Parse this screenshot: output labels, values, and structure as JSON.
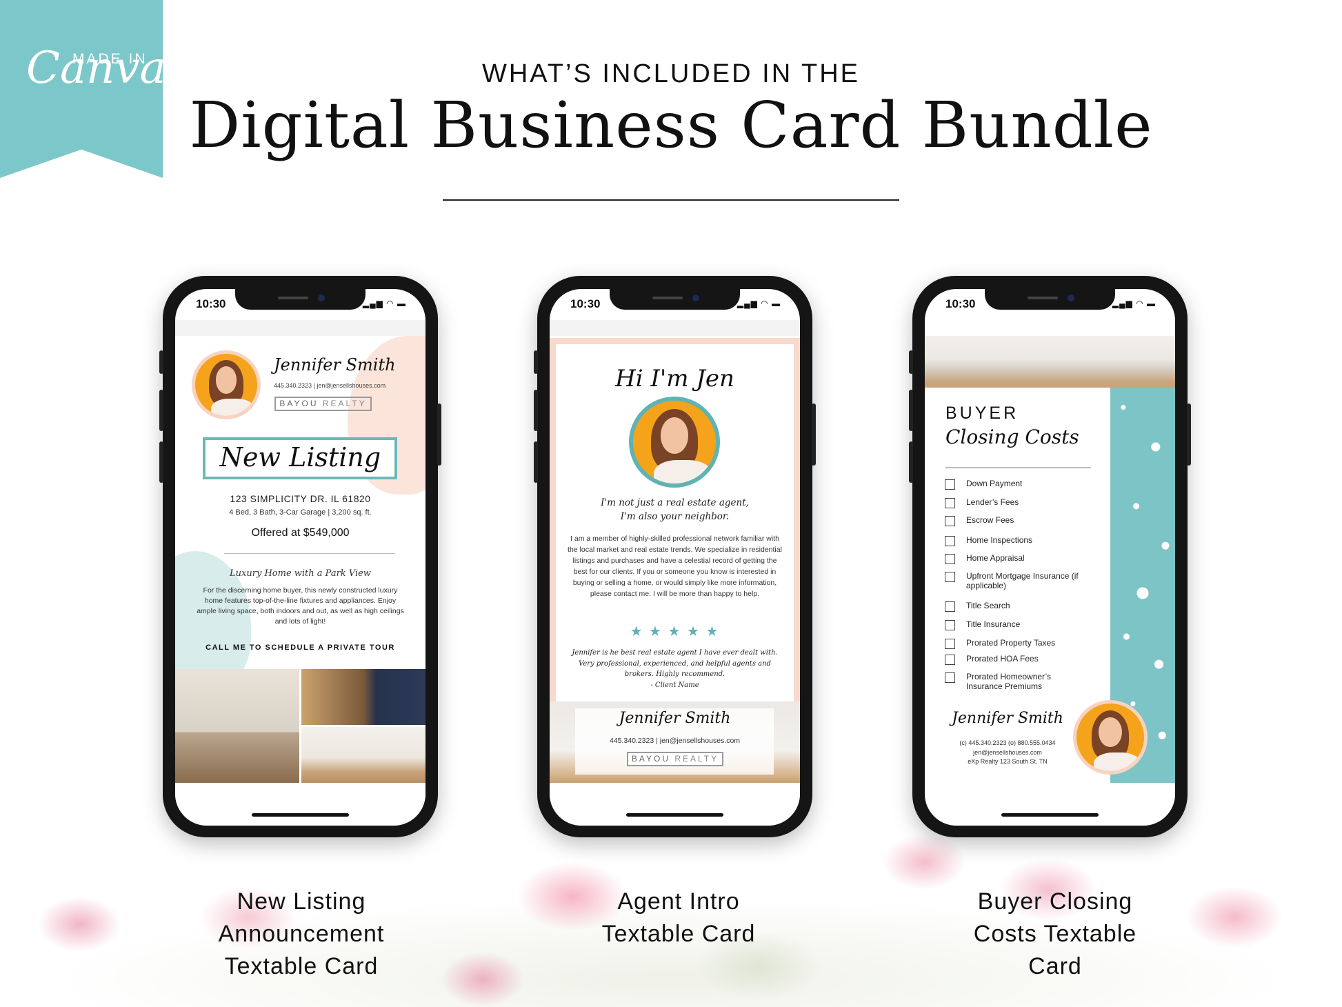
{
  "header": {
    "subtitle": "WHAT’S INCLUDED IN THE",
    "title": "Digital Business Card Bundle"
  },
  "badge": {
    "made_in": "MADE IN",
    "brand": "Canva",
    "color": "#7cc7c9"
  },
  "status_bar": {
    "time": "10:30"
  },
  "agent": {
    "name": "Jennifer Smith",
    "phone_email": "445.340.2323 | jen@jensellshouses.com",
    "brokerage_a": "BAYOU",
    "brokerage_b": "REALTY"
  },
  "card1": {
    "banner": "New Listing",
    "address": "123 SIMPLICITY DR. IL 61820",
    "specs": "4 Bed, 3 Bath, 3-Car Garage | 3,200 sq. ft.",
    "price": "Offered at $549,000",
    "headline": "Luxury Home with a Park View",
    "description": "For the discerning home buyer, this newly constructed luxury home features top-of-the-line fixtures and appliances. Enjoy ample living space, both indoors and out, as well as high ceilings and lots of light!",
    "cta": "CALL ME TO SCHEDULE A PRIVATE TOUR",
    "caption": [
      "New Listing",
      "Announcement",
      "Textable Card"
    ]
  },
  "card2": {
    "greeting": "Hi I'm Jen",
    "tagline1": "I'm not just a real estate agent,",
    "tagline2": "I'm also your neighbor.",
    "bio": "I am a member of highly-skilled professional network familiar with the local market and real estate trends. We specialize in residential listings and purchases and have a celestial record of getting the best for our clients. If you or someone you know is interested in buying or selling a home, or would simply like more information, please contact me. I will be more than happy to help.",
    "rating": 5,
    "stars": "★ ★ ★ ★ ★",
    "testimonial": "Jennifer is he best real estate agent I have ever dealt with. Very professional, experienced, and helpful agents and brokers. Highly recommend.",
    "testimonial_author": "- Client Name",
    "caption": [
      "Agent Intro",
      "Textable Card"
    ]
  },
  "card3": {
    "title1": "BUYER",
    "title2": "Closing Costs",
    "items": [
      "Down Payment",
      "Lender’s Fees",
      "Escrow Fees",
      "Home Inspections",
      "Home Appraisal",
      "Upfront Mortgage Insurance (if applicable)",
      "Title Search",
      "Title Insurance",
      "Prorated Property Taxes",
      "Prorated HOA Fees",
      "Prorated Homeowner’s Insurance Premiums"
    ],
    "contact": [
      "(c) 445.340.2323 (o) 880.555.0434",
      "jen@jensellshouses.com",
      "eXp Realty 123 South St, TN"
    ],
    "caption": [
      "Buyer Closing",
      "Costs Textable",
      "Card"
    ]
  },
  "colors": {
    "teal": "#5fb3b5",
    "peach": "#f8d9cc",
    "orange": "#f4a31b"
  }
}
